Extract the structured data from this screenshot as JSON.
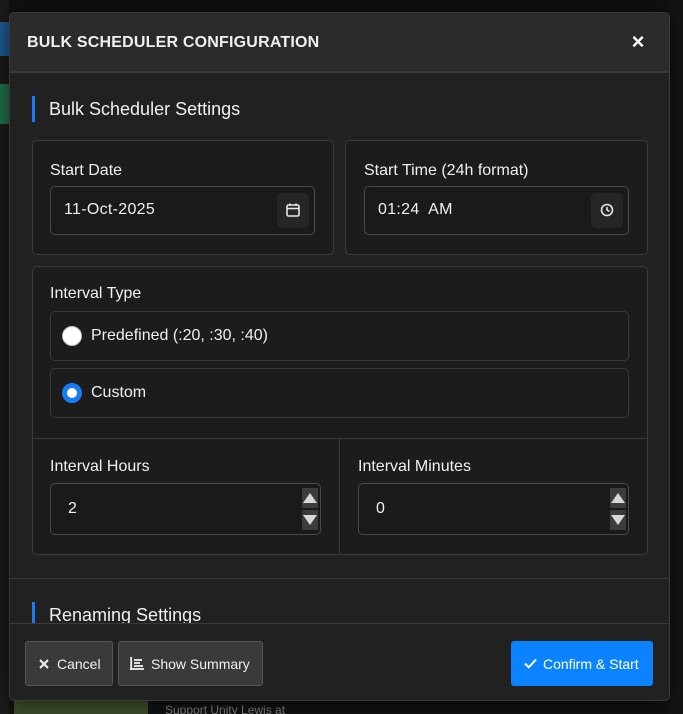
{
  "background": {
    "partial_text": "Support Unity Lewis at"
  },
  "modal": {
    "title": "BULK SCHEDULER CONFIGURATION",
    "close_label": "×",
    "sections": {
      "scheduler_heading": "Bulk Scheduler Settings",
      "renaming_heading": "Renaming Settings"
    },
    "start_date": {
      "label": "Start Date",
      "value": "11-Oct-2025",
      "icon": "calendar-icon"
    },
    "start_time": {
      "label": "Start Time (24h format)",
      "value": "01:24  AM",
      "icon": "clock-icon"
    },
    "interval_type": {
      "label": "Interval Type",
      "options": [
        {
          "label": "Predefined (:20, :30, :40)",
          "checked": false
        },
        {
          "label": "Custom",
          "checked": true
        }
      ]
    },
    "interval_hours": {
      "label": "Interval Hours",
      "value": "2"
    },
    "interval_minutes": {
      "label": "Interval Minutes",
      "value": "0"
    },
    "footer": {
      "cancel_label": "Cancel",
      "summary_label": "Show Summary",
      "confirm_label": "Confirm & Start"
    },
    "colors": {
      "accent": "#1a7cf5",
      "primary_button": "#0b83ff",
      "surface": "#212121",
      "border": "#3a3a3a"
    }
  }
}
